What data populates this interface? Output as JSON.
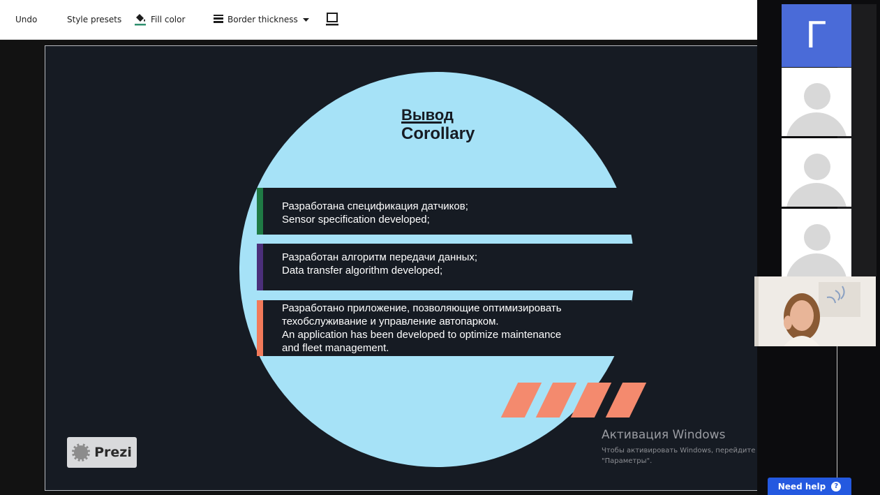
{
  "toolbar": {
    "undo": "Undo",
    "style_presets": "Style presets",
    "fill_color": "Fill color",
    "border_thickness": "Border thickness",
    "fill_accent": "#2f8f6e"
  },
  "slide": {
    "title_ru": "Вывод",
    "title_en": "Corollary",
    "items": [
      {
        "lines": [
          "Разработана спецификация датчиков;",
          "Sensor specification developed;"
        ],
        "accent": "#1f7a44"
      },
      {
        "lines": [
          "Разработан алгоритм передачи данных;",
          "Data transfer algorithm developed;"
        ],
        "accent": "#4b2f7a"
      },
      {
        "lines": [
          "Разработано приложение, позволяющие оптимизировать",
          "техобслуживание и управление автопарком.",
          "An application has been developed to optimize maintenance",
          "and fleet management."
        ],
        "accent": "#f27a5a"
      }
    ],
    "circle_color": "#a6e2f7",
    "stripe_color": "#f48a6e",
    "background": "#161b23"
  },
  "branding": {
    "prezi": "Prezi"
  },
  "watermark": {
    "title": "Активация Windows",
    "subtitle": "Чтобы активировать Windows, перейдите в раздел \"Параметры\"."
  },
  "participants": {
    "letter": "Г",
    "letter_bg": "#4a6bd8"
  },
  "help": {
    "label": "Need help",
    "icon": "?"
  }
}
